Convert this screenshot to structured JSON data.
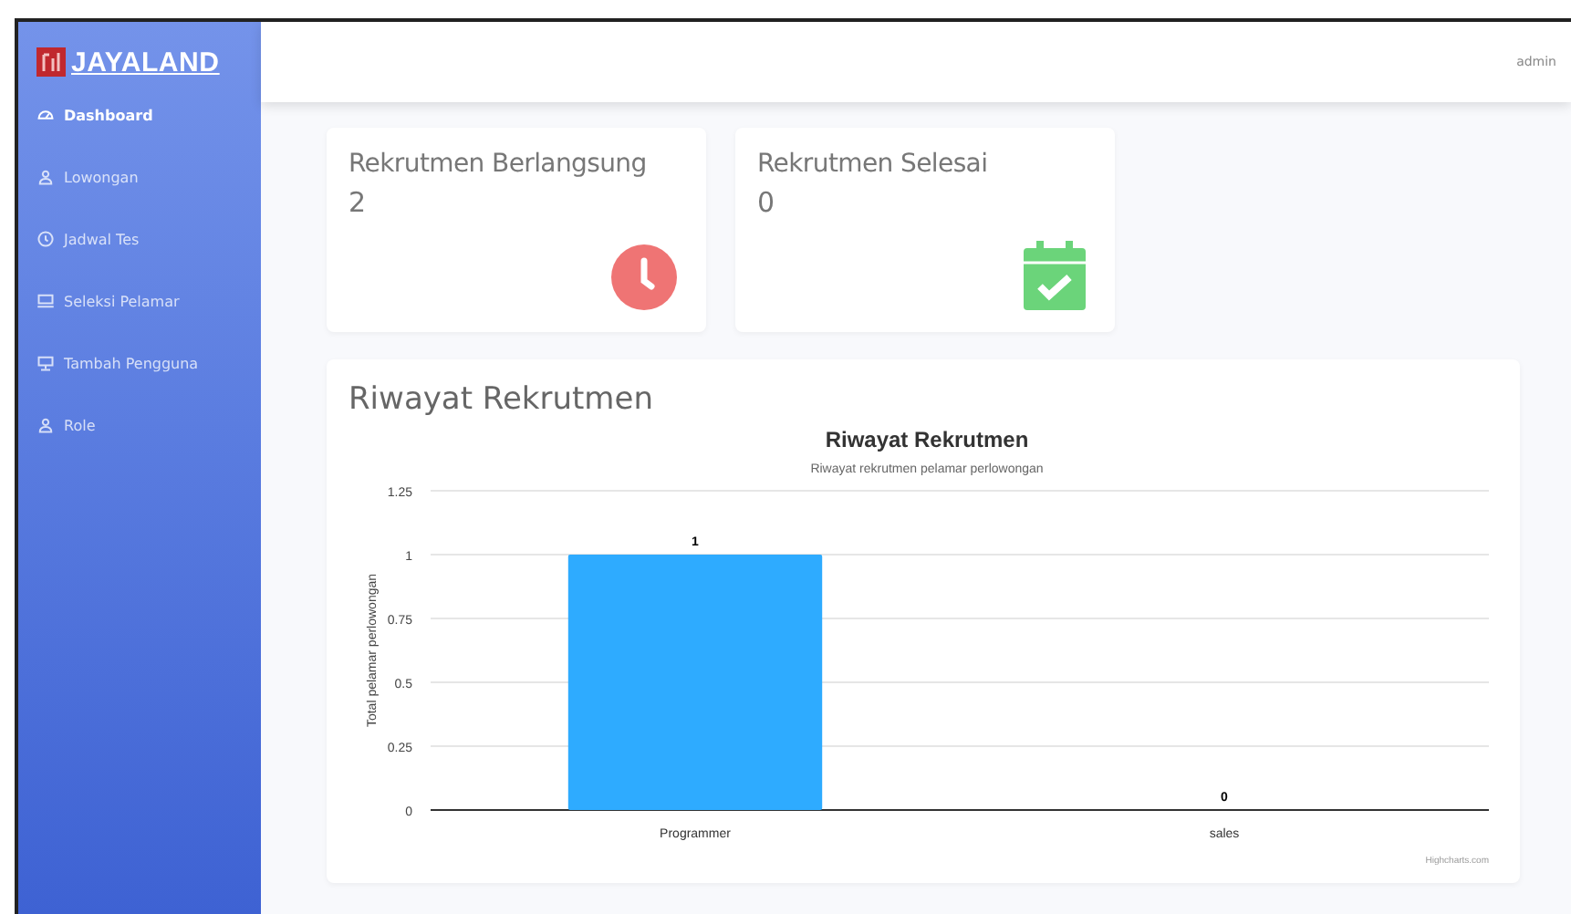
{
  "sidebar": {
    "brand": "JAYALAND",
    "items": [
      {
        "label": "Dashboard",
        "selected": true
      },
      {
        "label": "Lowongan",
        "selected": false
      },
      {
        "label": "Jadwal Tes",
        "selected": false
      },
      {
        "label": "Seleksi Pelamar",
        "selected": false
      },
      {
        "label": "Tambah Pengguna",
        "selected": false
      },
      {
        "label": "Role",
        "selected": false
      }
    ]
  },
  "topbar": {
    "user": "admin"
  },
  "stat_cards": [
    {
      "title": "Rekrutmen Berlangsung",
      "value": "2",
      "kind": "clock"
    },
    {
      "title": "Rekrutmen Selesai",
      "value": "0",
      "kind": "calendar"
    }
  ],
  "chart_card": {
    "heading": "Riwayat Rekrutmen",
    "credit": "Highcharts.com",
    "chart_data": {
      "type": "bar",
      "title": "Riwayat Rekrutmen",
      "subtitle": "Riwayat rekrutmen pelamar perlowongan",
      "ylabel": "Total pelamar perlowongan",
      "categories": [
        "Programmer",
        "sales"
      ],
      "series": [
        {
          "color": "#2eabff",
          "values": [
            1,
            0
          ]
        }
      ],
      "grid": true,
      "ylim": [
        0,
        1.25
      ],
      "yticks": [
        0,
        0.25,
        0.5,
        0.75,
        1,
        1.25
      ],
      "data_labels": true
    }
  }
}
